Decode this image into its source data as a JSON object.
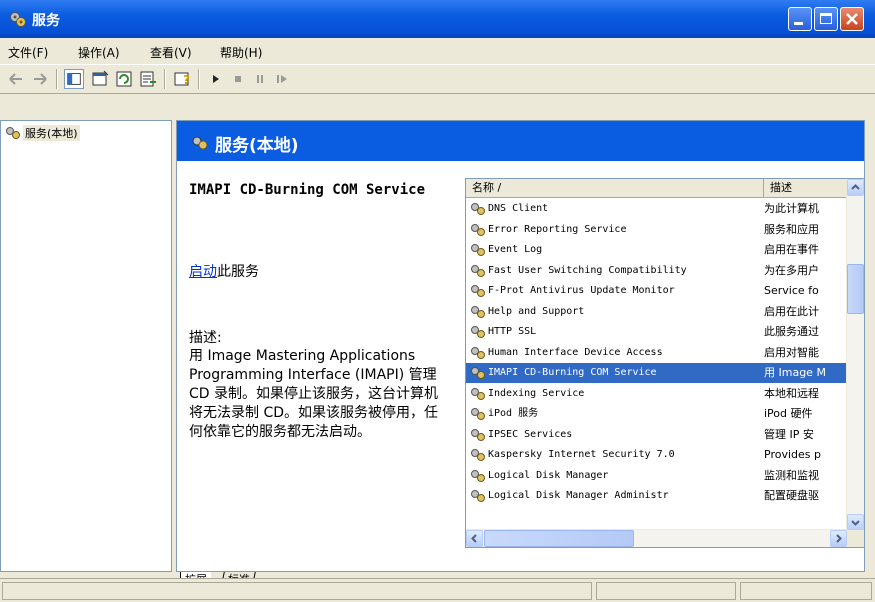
{
  "window": {
    "title": "服务",
    "icon": "services-gears-icon",
    "controls": [
      "minimize-icon",
      "maximize-icon",
      "close-icon"
    ],
    "colors": {
      "titlebar": "#0a5ce0",
      "banner": "#0a5ce0",
      "selection": "#316ac5",
      "link": "#0033cc"
    }
  },
  "menubar": {
    "items": [
      "文件(F)",
      "操作(A)",
      "查看(V)",
      "帮助(H)"
    ]
  },
  "toolbar": {
    "icons": [
      "back-arrow-icon",
      "forward-arrow-icon",
      "console-tree-icon",
      "properties-icon",
      "refresh-icon",
      "export-list-icon",
      "help-icon",
      "play-icon",
      "stop-icon",
      "pause-icon",
      "restart-icon"
    ]
  },
  "tree": {
    "root_label": "服务(本地)"
  },
  "banner": {
    "title": "服务(本地)"
  },
  "details": {
    "service_name": "IMAPI CD-Burning COM Service",
    "start_link": "启动",
    "start_suffix": "此服务",
    "description_label": "描述:",
    "description": "用 Image Mastering Applications Programming Interface (IMAPI) 管理 CD 录制。如果停止该服务，这台计算机将无法录制 CD。如果该服务被停用，任何依靠它的服务都无法启动。"
  },
  "list": {
    "columns": {
      "name": "名称 /",
      "description": "描述"
    },
    "rows": [
      {
        "name": "DNS Client",
        "desc": "为此计算机"
      },
      {
        "name": "Error Reporting Service",
        "desc": "服务和应用"
      },
      {
        "name": "Event Log",
        "desc": "启用在事件"
      },
      {
        "name": "Fast User Switching Compatibility",
        "desc": "为在多用户"
      },
      {
        "name": "F-Prot Antivirus Update Monitor",
        "desc": "Service fo"
      },
      {
        "name": "Help and Support",
        "desc": "启用在此计"
      },
      {
        "name": "HTTP SSL",
        "desc": "此服务通过"
      },
      {
        "name": "Human Interface Device Access",
        "desc": "启用对智能"
      },
      {
        "name": "IMAPI CD-Burning COM Service",
        "desc": "用 Image M"
      },
      {
        "name": "Indexing Service",
        "desc": "本地和远程"
      },
      {
        "name": "iPod 服务",
        "desc": "iPod 硬件"
      },
      {
        "name": "IPSEC Services",
        "desc": "管理 IP 安"
      },
      {
        "name": "Kaspersky Internet Security 7.0",
        "desc": "Provides p"
      },
      {
        "name": "Logical Disk Manager",
        "desc": "监测和监视"
      },
      {
        "name": "Logical Disk Manager Administr",
        "desc": "配置硬盘驱"
      }
    ],
    "selected_index": 8
  },
  "tabs": [
    "扩展",
    "标准"
  ],
  "statusbar": {
    "text": ""
  }
}
